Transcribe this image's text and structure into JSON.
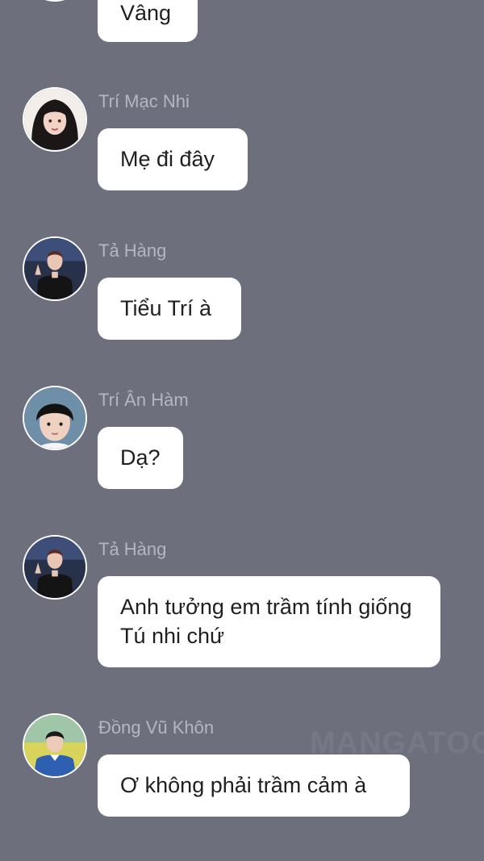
{
  "messages": [
    {
      "sender": "",
      "text": "Vâng",
      "avatar_icon": "avatar-partial"
    },
    {
      "sender": "Trí Mạc Nhi",
      "text": "Mẹ đi đây",
      "avatar_icon": "avatar-woman-dark-hair"
    },
    {
      "sender": "Tả Hàng",
      "text": "Tiểu Trí à",
      "avatar_icon": "avatar-boy-peace-sign"
    },
    {
      "sender": "Trí Ân Hàm",
      "text": "Dạ?",
      "avatar_icon": "avatar-child-black-hair"
    },
    {
      "sender": "Tả Hàng",
      "text": "Anh tưởng em trầm tính giống Tú nhi chứ",
      "avatar_icon": "avatar-boy-peace-sign"
    },
    {
      "sender": "Đồng Vũ Khôn",
      "text": "Ơ không phải trầm cảm à",
      "avatar_icon": "avatar-boy-blue-shirt"
    }
  ],
  "watermark": "MANGATOO",
  "colors": {
    "background": "#6d6f7d",
    "bubble": "#ffffff",
    "sender_name": "#b4b6c2",
    "message_text": "#1f1f1f"
  }
}
